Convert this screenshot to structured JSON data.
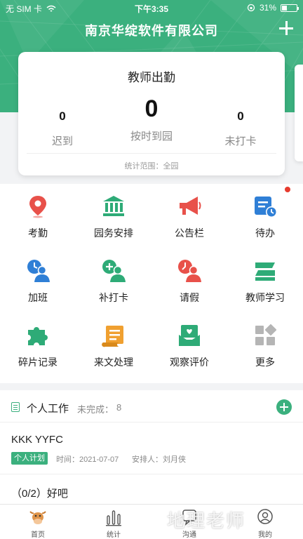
{
  "status_bar": {
    "carrier": "无 SIM 卡",
    "time": "下午3:35",
    "battery": "31%"
  },
  "header": {
    "title": "南京华绽软件有限公司",
    "add_icon": "plus-icon"
  },
  "attendance": {
    "title": "教师出勤",
    "stats": [
      {
        "value": "0",
        "label": "迟到"
      },
      {
        "value": "0",
        "label": "按时到园"
      },
      {
        "value": "0",
        "label": "未打卡"
      }
    ],
    "footer": "统计范围：全园"
  },
  "grid": [
    {
      "label": "考勤",
      "icon": "location-pin-icon",
      "color": "#e8514a"
    },
    {
      "label": "园务安排",
      "icon": "bank-icon",
      "color": "#2eab77"
    },
    {
      "label": "公告栏",
      "icon": "megaphone-icon",
      "color": "#e8514a"
    },
    {
      "label": "待办",
      "icon": "todo-clock-icon",
      "color": "#2f7fd6",
      "badge": true
    },
    {
      "label": "加班",
      "icon": "overtime-user-icon",
      "color": "#2f7fd6"
    },
    {
      "label": "补打卡",
      "icon": "add-user-icon",
      "color": "#2eab77"
    },
    {
      "label": "请假",
      "icon": "leave-user-icon",
      "color": "#e8514a"
    },
    {
      "label": "教师学习",
      "icon": "stack-icon",
      "color": "#2eab77"
    },
    {
      "label": "碎片记录",
      "icon": "puzzle-icon",
      "color": "#2eab77"
    },
    {
      "label": "来文处理",
      "icon": "scroll-icon",
      "color": "#f0a030"
    },
    {
      "label": "观察评价",
      "icon": "heart-inbox-icon",
      "color": "#2eab77"
    },
    {
      "label": "更多",
      "icon": "more-apps-icon",
      "color": "#aaaaaa"
    }
  ],
  "work": {
    "title": "个人工作",
    "pending_label": "未完成：",
    "pending_count": "8",
    "tasks": [
      {
        "title": "KKK YYFC",
        "tag": "个人计划",
        "time": "时间：2021-07-07",
        "assigner": "安排人：刘月侠"
      },
      {
        "title": "（0/2）好吧"
      }
    ]
  },
  "tabs": [
    {
      "label": "首页",
      "icon": "cow-icon"
    },
    {
      "label": "统计",
      "icon": "bar-chart-icon"
    },
    {
      "label": "沟通",
      "icon": "chat-icon"
    },
    {
      "label": "我的",
      "icon": "user-icon"
    }
  ],
  "watermark": "地理老师"
}
